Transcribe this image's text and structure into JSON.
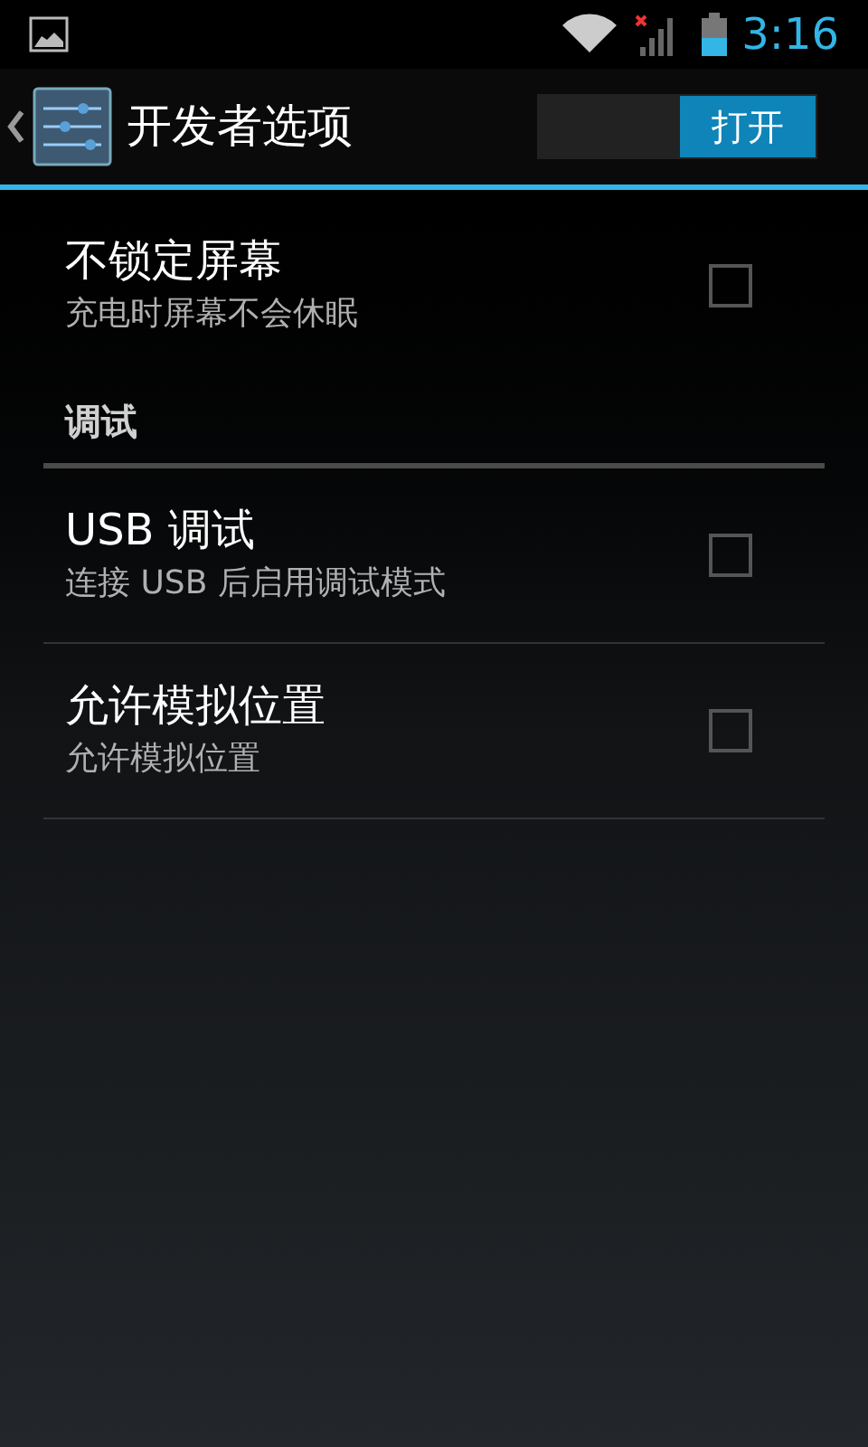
{
  "status_bar": {
    "time": "3:16"
  },
  "action_bar": {
    "title": "开发者选项",
    "toggle": {
      "label": "打开",
      "on": true
    }
  },
  "items": [
    {
      "kind": "checkbox",
      "title": "不锁定屏幕",
      "summary": "充电时屏幕不会休眠",
      "checked": false
    },
    {
      "kind": "header",
      "title": "调试"
    },
    {
      "kind": "checkbox",
      "title": "USB 调试",
      "summary": "连接 USB 后启用调试模式",
      "checked": false
    },
    {
      "kind": "checkbox",
      "title": "允许模拟位置",
      "summary": "允许模拟位置",
      "checked": false
    }
  ]
}
